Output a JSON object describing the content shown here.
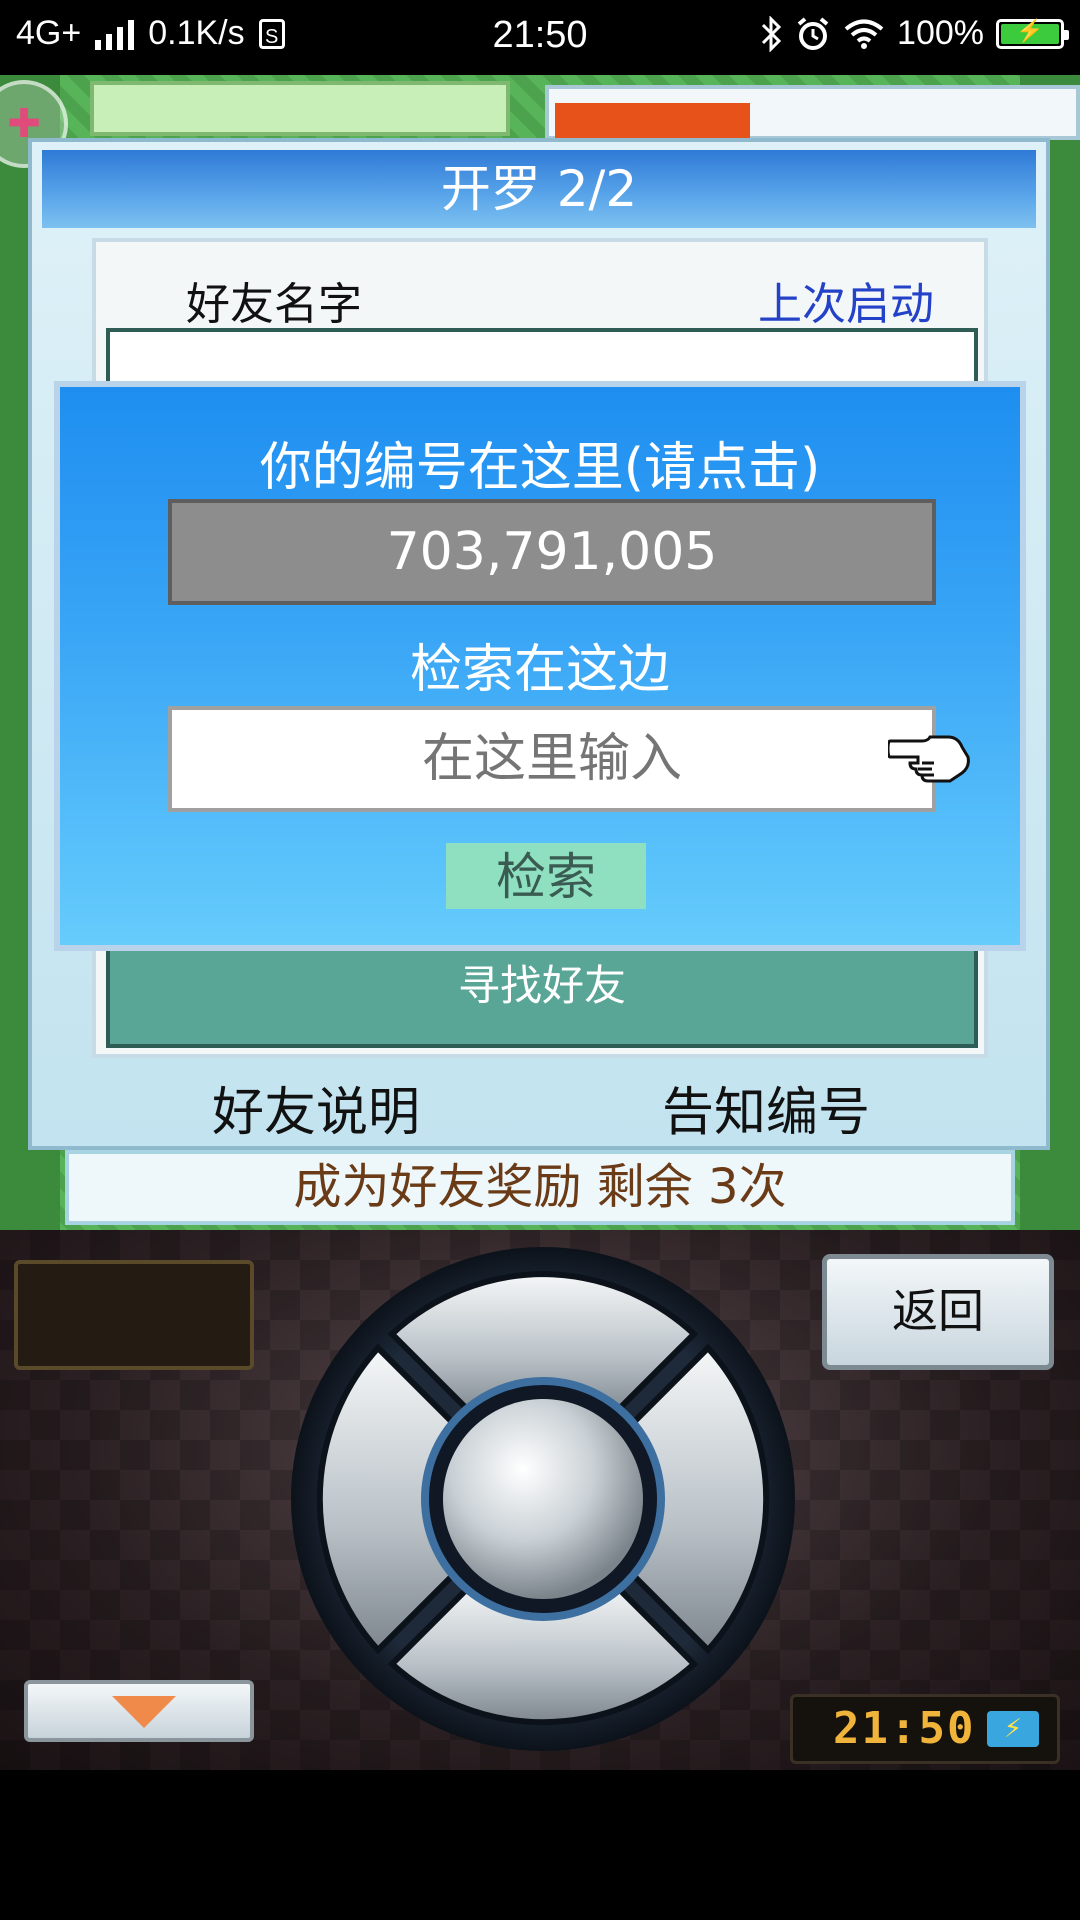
{
  "status_bar": {
    "network": "4G+",
    "speed": "0.1K/s",
    "sim_badge": "S",
    "time": "21:50",
    "battery": "100%",
    "icons": [
      "signal-icon",
      "bluetooth-icon",
      "alarm-icon",
      "wifi-icon",
      "battery-icon"
    ]
  },
  "dialog": {
    "title": "开罗 2/2",
    "column_name": "好友名字",
    "column_last": "上次启动",
    "find_friends": "寻找好友",
    "footer_left": "好友说明",
    "footer_right": "告知编号",
    "reward_text": "成为好友奖励 剩余 3次"
  },
  "popup": {
    "your_id_label": "你的编号在这里(请点击)",
    "your_id": "703,791,005",
    "search_label": "检索在这边",
    "search_placeholder": "在这里输入",
    "search_button": "检索"
  },
  "controller": {
    "back_button": "返回",
    "clock": "21:50"
  },
  "colors": {
    "popup_top": "#1e8ef0",
    "popup_bottom": "#66ccfc",
    "id_box": "#8d8d8d",
    "search_button": "#8fe0c0",
    "find_friends": "#5aa696",
    "link_blue": "#2442c8",
    "reward_text": "#6a3b16"
  }
}
